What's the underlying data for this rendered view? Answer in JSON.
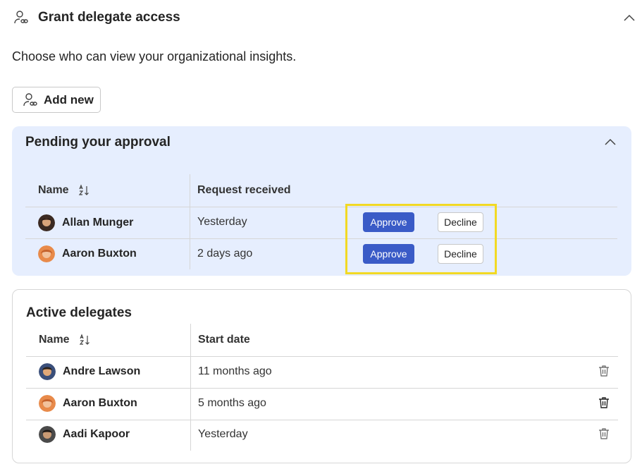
{
  "header": {
    "title": "Grant delegate access",
    "icon": "person-link-icon",
    "collapse_icon": "chevron-up-icon"
  },
  "subtitle": "Choose who can view your organizational insights.",
  "add_button": {
    "label": "Add new",
    "icon": "person-link-icon"
  },
  "pending": {
    "title": "Pending your approval",
    "columns": {
      "name": "Name",
      "date": "Request received"
    },
    "rows": [
      {
        "name": "Allan Munger",
        "date": "Yesterday",
        "approve": "Approve",
        "decline": "Decline"
      },
      {
        "name": "Aaron Buxton",
        "date": "2 days ago",
        "approve": "Approve",
        "decline": "Decline"
      }
    ]
  },
  "active": {
    "title": "Active delegates",
    "columns": {
      "name": "Name",
      "date": "Start date"
    },
    "rows": [
      {
        "name": "Andre Lawson",
        "date": "11 months ago"
      },
      {
        "name": "Aaron Buxton",
        "date": "5 months ago"
      },
      {
        "name": "Aadi Kapoor",
        "date": "Yesterday"
      }
    ]
  },
  "colors": {
    "approve": "#3a5bc7",
    "pending_bg": "#e6eefe",
    "highlight": "#f2d923"
  }
}
